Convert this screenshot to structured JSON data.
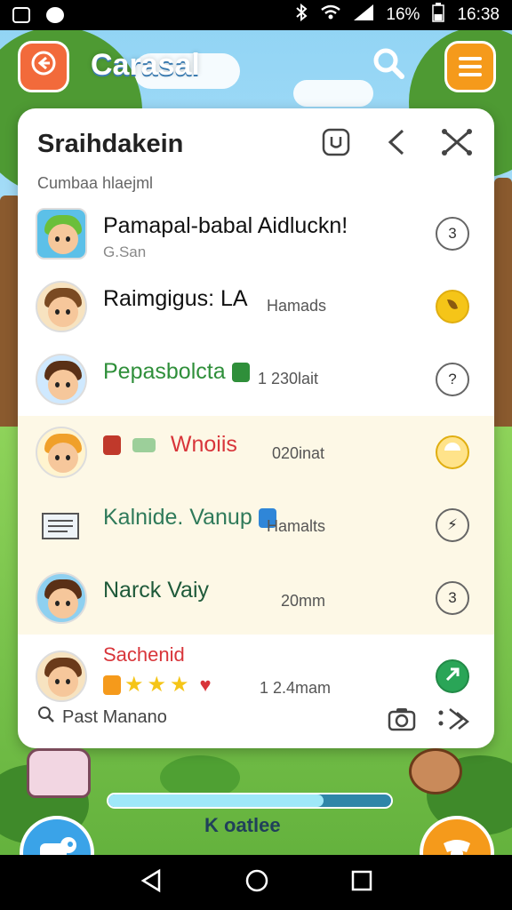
{
  "status_bar": {
    "battery": "16%",
    "time": "16:38"
  },
  "app_bar": {
    "title": "Carasal"
  },
  "card": {
    "title": "Sraihdakein",
    "subtitle": "Cumbaa hlaejml",
    "items": [
      {
        "main": "Pamapal-babal Aidluckn!",
        "sub": "G.San",
        "meta": "",
        "action": "3"
      },
      {
        "main": "Raimgigus: LA",
        "sub": "",
        "meta": "Hamads",
        "action": ""
      },
      {
        "main": "Pepasbolcta",
        "sub": "",
        "meta": "1 230lait",
        "action": "?"
      },
      {
        "main": "Wnoiis",
        "sub": "",
        "meta": "020inat",
        "action": ""
      },
      {
        "main": "Kalnide. Vanup",
        "sub": "",
        "meta": "Hamalts",
        "action": "⚡"
      },
      {
        "main": "Narck Vaiy",
        "sub": "",
        "meta": "20mm",
        "action": "3"
      },
      {
        "main": "Sachenid",
        "sub": "",
        "meta": "1 2.4mam",
        "action": ""
      }
    ],
    "footer_search": "Past Manano"
  },
  "progress": {
    "label": "K oatlee",
    "fraction": 0.76
  },
  "colors": {
    "accent_orange": "#f26a3b",
    "menu_orange": "#f59a1b",
    "sky": "#8fd3f4"
  },
  "icons": [
    "back-arrow-icon",
    "search-icon",
    "menu-icon",
    "share-icon",
    "chevron-left-icon",
    "close-icon",
    "camera-icon",
    "more-icon",
    "dog-icon",
    "paw-icon"
  ]
}
